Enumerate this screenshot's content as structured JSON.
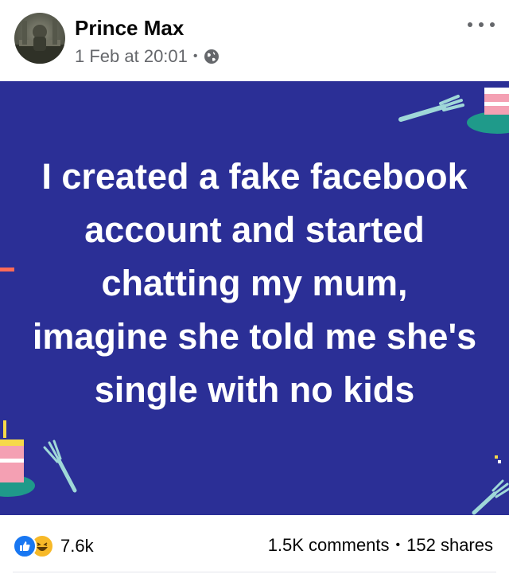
{
  "post": {
    "author": "Prince Max",
    "date": "1 Feb at 20:01",
    "privacy_icon": "globe-icon",
    "text": "I created a fake facebook account and started chatting my mum, imagine she told me she's single with no kids",
    "background_color": "#2b2f96"
  },
  "engagement": {
    "reaction_count": "7.6k",
    "reaction_icons": [
      "like-icon",
      "haha-icon"
    ],
    "comments": "1.5K comments",
    "shares": "152 shares"
  },
  "colors": {
    "like_blue": "#1877f2",
    "haha_yellow": "#f7b928",
    "secondary_text": "#65676b"
  }
}
